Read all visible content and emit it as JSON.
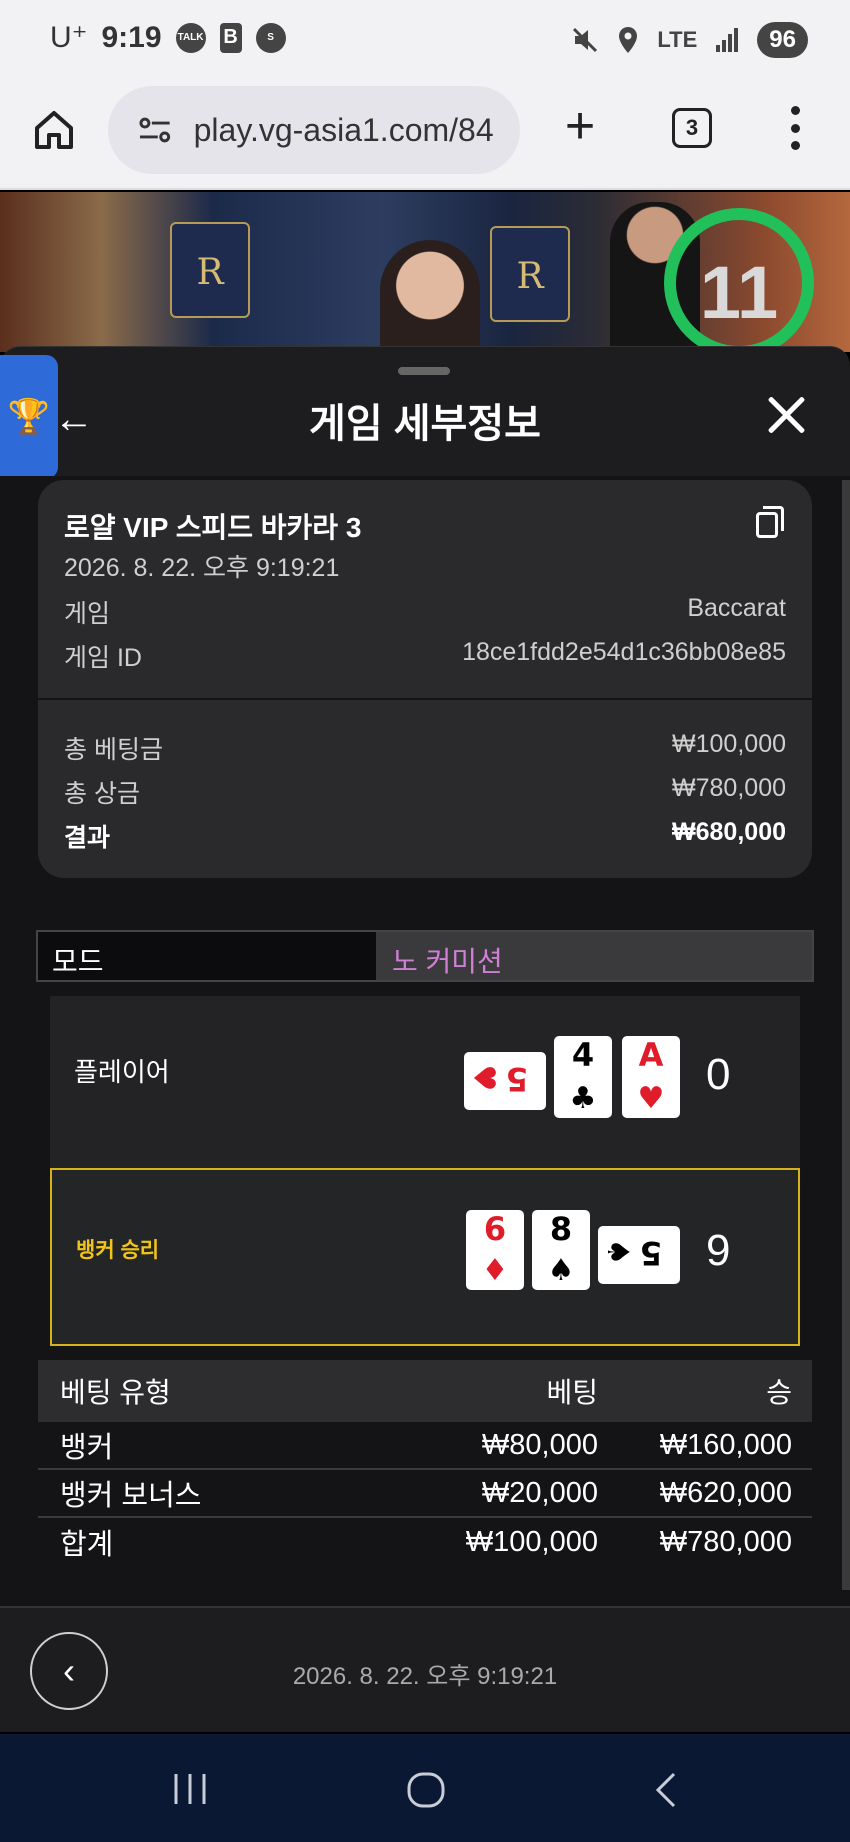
{
  "status_bar": {
    "carrier": "U⁺",
    "time": "9:19",
    "network": "LTE",
    "battery": "96"
  },
  "browser": {
    "url": "play.vg-asia1.com/84",
    "tab_count": "3"
  },
  "video": {
    "countdown": "11"
  },
  "panel": {
    "title": "게임 세부정보"
  },
  "game": {
    "table_name": "로얄 VIP 스피드 바카라 3",
    "datetime": "2026. 8. 22. 오후 9:19:21",
    "game_label": "게임",
    "game_value": "Baccarat",
    "game_id_label": "게임 ID",
    "game_id_value": "18ce1fdd2e54d1c36bb08e85"
  },
  "totals": {
    "total_bet_label": "총 베팅금",
    "total_bet_value": "₩100,000",
    "total_win_label": "총 상금",
    "total_win_value": "₩780,000",
    "result_label": "결과",
    "result_value": "₩680,000"
  },
  "mode": {
    "label": "모드",
    "value": "노 커미션"
  },
  "player": {
    "label": "플레이어",
    "score": "0",
    "cards": [
      {
        "rank": "5",
        "suit": "♥",
        "color": "#e01c2a",
        "orientation": "sideways"
      },
      {
        "rank": "4",
        "suit": "♣",
        "color": "#000000",
        "orientation": "upright"
      },
      {
        "rank": "A",
        "suit": "♥",
        "color": "#e01c2a",
        "orientation": "upright"
      }
    ]
  },
  "banker": {
    "label": "뱅커 승리",
    "score": "9",
    "highlight_color": "#d6b31c",
    "cards": [
      {
        "rank": "6",
        "suit": "♦",
        "color": "#e01c2a",
        "orientation": "upright"
      },
      {
        "rank": "8",
        "suit": "♠",
        "color": "#000000",
        "orientation": "upright"
      },
      {
        "rank": "5",
        "suit": "♠",
        "color": "#000000",
        "orientation": "sideways"
      }
    ]
  },
  "bets": {
    "headers": [
      "베팅 유형",
      "베팅",
      "승"
    ],
    "rows": [
      [
        "뱅커",
        "₩80,000",
        "₩160,000"
      ],
      [
        "뱅커 보너스",
        "₩20,000",
        "₩620,000"
      ],
      [
        "합계",
        "₩100,000",
        "₩780,000"
      ]
    ]
  },
  "footer": {
    "datetime": "2026. 8. 22. 오후 9:19:21"
  },
  "icons": {
    "trophy": "🏆",
    "back": "←",
    "prev": "‹"
  }
}
